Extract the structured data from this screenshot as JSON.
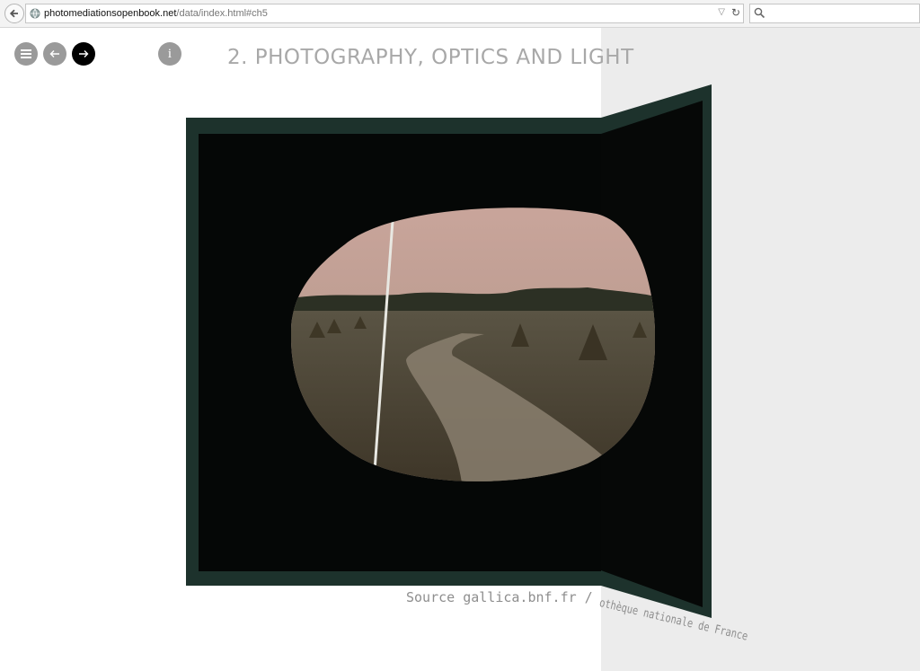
{
  "browser": {
    "url_host": "photomediationsopenbook.net",
    "url_path": "/data/index.html#ch5"
  },
  "page": {
    "chapter_title": "2. PHOTOGRAPHY, OPTICS AND LIGHT",
    "nav": {
      "menu_icon": "hamburger-menu-icon",
      "prev_icon": "arrow-left-icon",
      "next_icon": "arrow-right-icon",
      "info_label": "i"
    },
    "caption_start": "Source gallica.bnf.fr / Bibli",
    "caption_end": "othèque nationale de France"
  },
  "colors": {
    "frame": "#1d322c",
    "title": "#a8a8a8",
    "next_active": "#000000",
    "nav_inactive": "#9a9a9a"
  }
}
